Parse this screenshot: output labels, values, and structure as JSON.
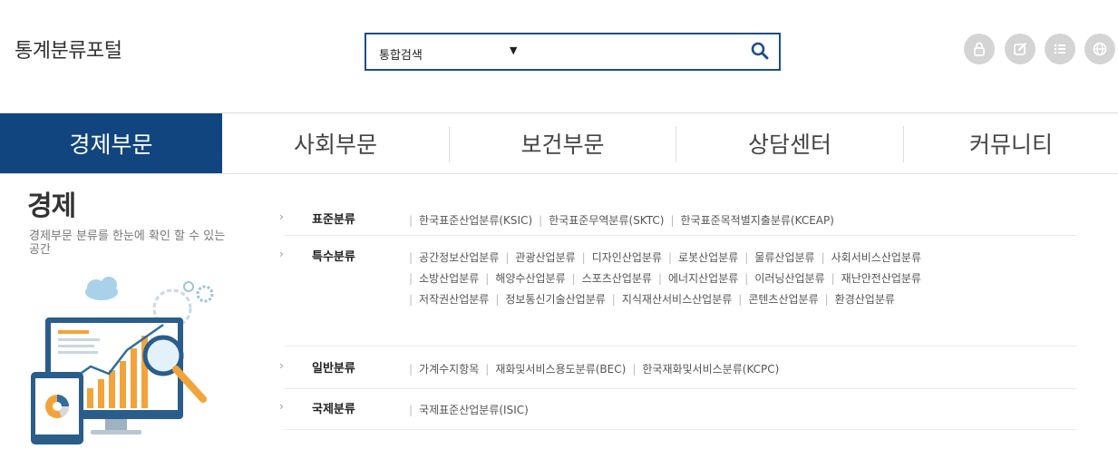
{
  "header": {
    "site_title": "통계분류포털",
    "search": {
      "scope_label": "통합검색",
      "caret": "▼",
      "value": "",
      "placeholder": ""
    },
    "utility_icons": [
      "lock-icon",
      "edit-icon",
      "list-icon",
      "globe-icon"
    ]
  },
  "nav": {
    "items": [
      {
        "label": "경제부문"
      },
      {
        "label": "사회부문"
      },
      {
        "label": "보건부문"
      },
      {
        "label": "상담센터"
      },
      {
        "label": "커뮤니티"
      }
    ]
  },
  "section": {
    "title": "경제",
    "description": "경제부문 분류를 한눈에 확인 할 수 있는 공간"
  },
  "categories": [
    {
      "arrow": "›",
      "name": "표준분류",
      "links": [
        "한국표준산업분류(KSIC)",
        "한국표준무역분류(SKTC)",
        "한국표준목적별지출분류(KCEAP)"
      ]
    },
    {
      "arrow": "›",
      "name": "특수분류",
      "links": [
        "공간정보산업분류",
        "관광산업분류",
        "디자인산업분류",
        "로봇산업분류",
        "물류산업분류",
        "사회서비스산업분류",
        "소방산업분류",
        "해양수산업분류",
        "스포츠산업분류",
        "에너지산업분류",
        "이러닝산업분류",
        "재난안전산업분류",
        "저작권산업분류",
        "정보통신기술산업분류",
        "지식재산서비스산업분류",
        "콘텐츠산업분류",
        "환경산업분류"
      ]
    },
    {
      "arrow": "›",
      "name": "일반분류",
      "links": [
        "가계수지항목",
        "재화및서비스용도분류(BEC)",
        "한국재화및서비스분류(KCPC)"
      ]
    },
    {
      "arrow": "›",
      "name": "국제분류",
      "links": [
        "국제표준산업분류(ISIC)"
      ]
    }
  ],
  "colors": {
    "nav_active_bg": "#11457f",
    "search_border": "#1d4f86",
    "utility_icon_bg": "#d4d4d4"
  }
}
